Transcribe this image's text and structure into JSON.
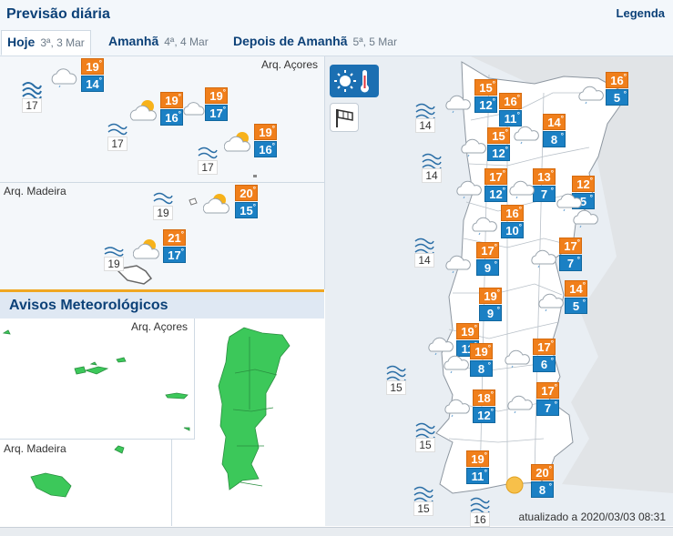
{
  "header": {
    "title": "Previsão diária",
    "legend": "Legenda",
    "tabs": [
      {
        "label": "Hoje",
        "date": "3ª, 3 Mar"
      },
      {
        "label": "Amanhã",
        "date": "4ª, 4 Mar"
      },
      {
        "label": "Depois de Amanhã",
        "date": "5ª, 5 Mar"
      }
    ]
  },
  "islands": {
    "acores_label": "Arq. Açores",
    "madeira_label": "Arq. Madeira",
    "acores_forecasts": [
      {
        "max": "19",
        "min": "14"
      },
      {
        "max": "19",
        "min": "16"
      },
      {
        "max": "19",
        "min": "17"
      },
      {
        "max": "19",
        "min": "16"
      }
    ],
    "acores_sea": [
      "17",
      "17",
      "17"
    ],
    "madeira_forecasts": [
      {
        "max": "20",
        "min": "15"
      },
      {
        "max": "21",
        "min": "17"
      }
    ],
    "madeira_sea": [
      "19",
      "19"
    ]
  },
  "avisos": {
    "title": "Avisos Meteorológicos",
    "acores_label": "Arq. Açores",
    "madeira_label": "Arq. Madeira",
    "color": "#3cc85a"
  },
  "mainland": {
    "forecasts": [
      {
        "max": "16",
        "min": "5"
      },
      {
        "max": "15",
        "min": "12"
      },
      {
        "max": "16",
        "min": "11"
      },
      {
        "max": "14",
        "min": "8"
      },
      {
        "max": "15",
        "min": "12"
      },
      {
        "max": "17",
        "min": "12"
      },
      {
        "max": "13",
        "min": "7"
      },
      {
        "max": "12",
        "min": "5"
      },
      {
        "max": "16",
        "min": "10"
      },
      {
        "max": "17",
        "min": "9"
      },
      {
        "max": "17",
        "min": "7"
      },
      {
        "max": "14",
        "min": "5"
      },
      {
        "max": "19",
        "min": "9"
      },
      {
        "max": "19",
        "min": "11"
      },
      {
        "max": "19",
        "min": "8"
      },
      {
        "max": "17",
        "min": "6"
      },
      {
        "max": "18",
        "min": "12"
      },
      {
        "max": "17",
        "min": "7"
      },
      {
        "max": "19",
        "min": "11"
      },
      {
        "max": "20",
        "min": "8"
      }
    ],
    "sea": [
      "14",
      "14",
      "14",
      "15",
      "15",
      "15",
      "16"
    ],
    "updated": "atualizado a 2020/03/03 08:31"
  },
  "colors": {
    "max": "#f07f1b",
    "min": "#1b80c4",
    "land": "#ffffff",
    "sea": "#e9eef3"
  }
}
